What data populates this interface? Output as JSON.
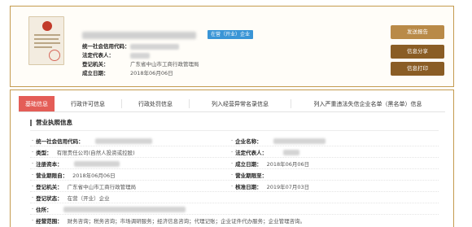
{
  "header": {
    "status_badge": "在营（开业）企业",
    "fields": [
      {
        "label": "统一社会信用代码：",
        "value": ""
      },
      {
        "label": "法定代表人：",
        "value": ""
      },
      {
        "label": "登记机关：",
        "value": "广东省中山市工商行政管理局"
      },
      {
        "label": "成立日期：",
        "value": "2018年06月06日"
      }
    ],
    "buttons": {
      "report": "发送报告",
      "share": "信息分享",
      "print": "信息打印"
    },
    "colors": {
      "accent": "#c49b4f",
      "badge": "#3a95d6",
      "button": "#8a5d25"
    }
  },
  "tabs": [
    {
      "label": "基础信息",
      "active": true
    },
    {
      "label": "行政许可信息",
      "active": false
    },
    {
      "label": "行政处罚信息",
      "active": false
    },
    {
      "label": "列入经营异常名录信息",
      "active": false
    },
    {
      "label": "列入严重违法失信企业名单（黑名单）信息",
      "active": false
    }
  ],
  "section": {
    "title": "营业执照信息",
    "rows": [
      {
        "left_label": "统一社会信用代码：",
        "left_value": "",
        "right_label": "企业名称：",
        "right_value": ""
      },
      {
        "left_label": "类型：",
        "left_value": "有限责任公司(自然人投资或控股)",
        "right_label": "法定代表人：",
        "right_value": ""
      },
      {
        "left_label": "注册资本：",
        "left_value": "",
        "right_label": "成立日期：",
        "right_value": "2018年06月06日"
      },
      {
        "left_label": "营业期限自：",
        "left_value": "2018年06月06日",
        "right_label": "营业期限至：",
        "right_value": ""
      },
      {
        "left_label": "登记机关：",
        "left_value": "广东省中山市工商行政管理局",
        "right_label": "核准日期：",
        "right_value": "2019年07月03日"
      },
      {
        "left_label": "登记状态：",
        "left_value": "在营（开业）企业",
        "right_label": "",
        "right_value": ""
      },
      {
        "left_label": "住所：",
        "left_value": "",
        "right_label": "",
        "right_value": ""
      },
      {
        "left_label": "经营范围：",
        "left_value": "财务咨询；税务咨询；市场调研服务；经济信息咨询；代理记账；企业证件代办服务；企业管理咨询。",
        "right_label": "",
        "right_value": ""
      }
    ]
  }
}
